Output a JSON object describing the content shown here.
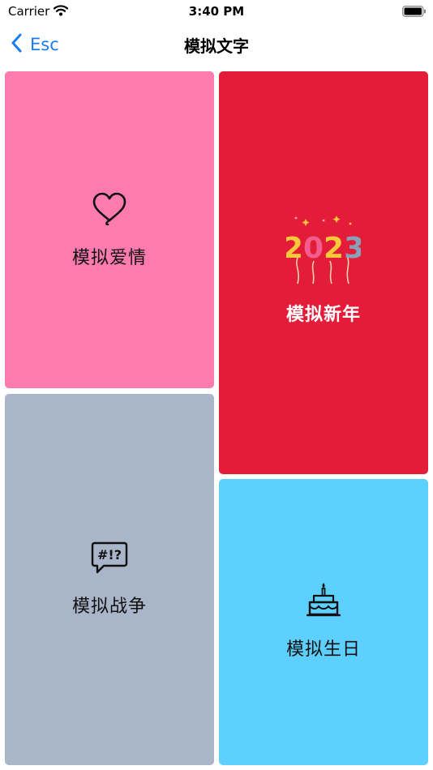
{
  "status_bar": {
    "carrier": "Carrier",
    "time": "3:40 PM"
  },
  "nav": {
    "back_label": "Esc",
    "title": "模拟文字"
  },
  "tiles": {
    "love": {
      "label": "模拟爱情",
      "icon": "heart-icon",
      "color": "#fd7bae"
    },
    "new_year": {
      "label": "模拟新年",
      "icon": "balloons-2023-icon",
      "badge_text": "2023",
      "color": "#e31c3a"
    },
    "war": {
      "label": "模拟战争",
      "icon": "speech-bubble-icon",
      "icon_text": "#!?",
      "color": "#a9b5c8"
    },
    "birthday": {
      "label": "模拟生日",
      "icon": "cake-icon",
      "color": "#5ed0ff"
    }
  },
  "colors": {
    "accent": "#1a7cf3"
  }
}
